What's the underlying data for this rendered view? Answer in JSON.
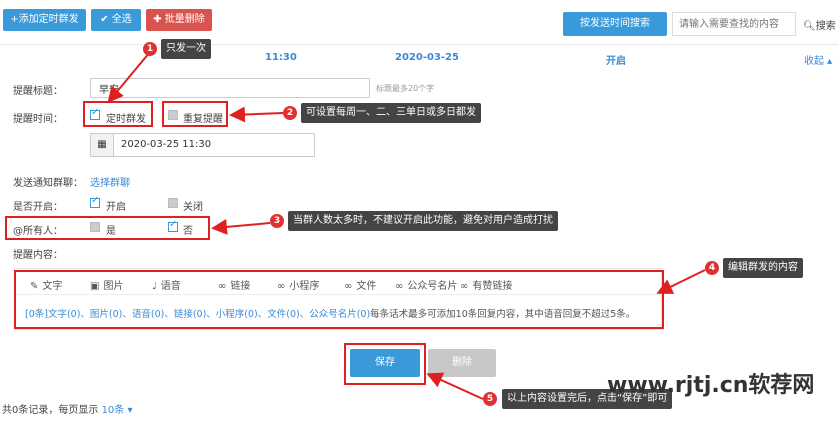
{
  "toolbar": {
    "add_label": "+添加定时群发",
    "select_all_label": "✔ 全选",
    "batch_delete_label": "✚ 批量删除",
    "search_by_time_label": "按发送时间搜索",
    "search_placeholder": "请输入需要查找的内容",
    "search_button_label": "搜索"
  },
  "summary_row": {
    "time": "11:30",
    "date": "2020-03-25",
    "status": "开启",
    "collapse_label": "收起"
  },
  "form": {
    "title_label": "提醒标题：",
    "title_value": "早安",
    "title_hint": "标题最多20个字",
    "time_label": "提醒时间：",
    "timed_send_label": "定时群发",
    "repeat_label": "重复提醒",
    "datetime_value": "2020-03-25 11:30",
    "notify_group_label": "发送通知群聊：",
    "select_group_link": "选择群聊",
    "enabled_label": "是否开启：",
    "on_label": "开启",
    "off_label": "关闭",
    "at_all_label": "@所有人：",
    "yes_label": "是",
    "no_label": "否",
    "content_label": "提醒内容："
  },
  "editor": {
    "tabs": [
      "文字",
      "图片",
      "语音",
      "链接",
      "小程序",
      "文件",
      "公众号名片",
      "有赞链接"
    ],
    "summary_link": "[0条]文字(0)、图片(0)、语音(0)、链接(0)、小程序(0)、文件(0)、公众号名片(0)",
    "summary_text": "每条话术最多可添加10条回复内容，其中语音回复不超过5条。"
  },
  "actions": {
    "save_label": "保存",
    "delete_label": "删除"
  },
  "pagination": {
    "total_text": "共0条记录，每页显示",
    "page_size": "10条 ▾"
  },
  "annotations": [
    {
      "num": "1",
      "text": "只发一次"
    },
    {
      "num": "2",
      "text": "可设置每周一、二、三单日或多日都发"
    },
    {
      "num": "3",
      "text": "当群人数太多时，不建议开启此功能，避免对用户造成打扰"
    },
    {
      "num": "4",
      "text": "编辑群发的内容"
    },
    {
      "num": "5",
      "text": "以上内容设置完后，点击“保存”即可"
    }
  ],
  "watermark": "www.rjtj.cn软荐网",
  "colors": {
    "accent": "#3a9ad9",
    "danger": "#d9534f",
    "annotation_red": "#e02020",
    "tip_bg": "#444444"
  }
}
